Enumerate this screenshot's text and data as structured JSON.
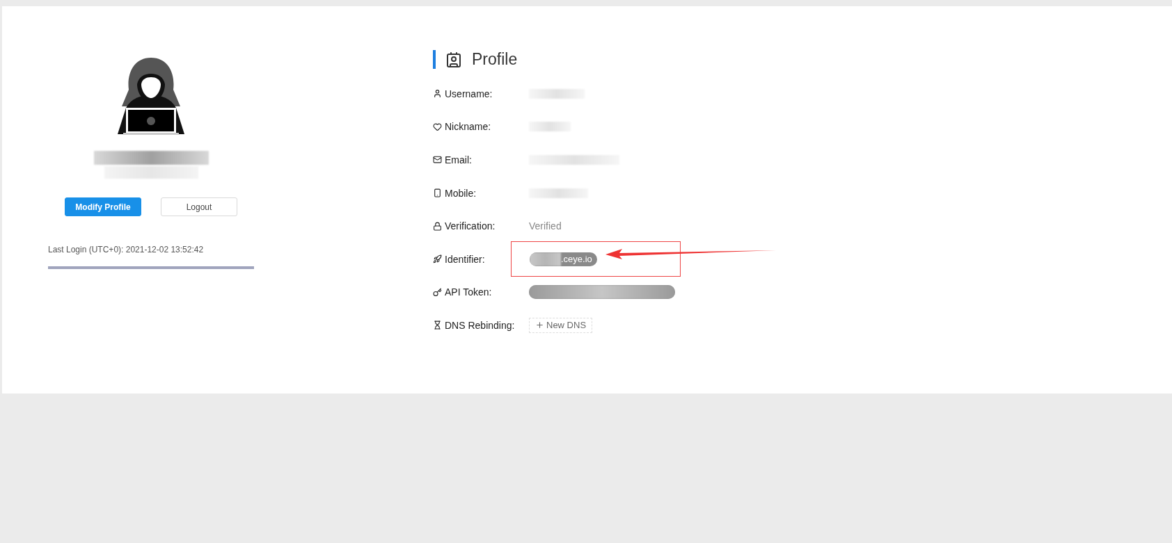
{
  "sidebar": {
    "buttons": [
      {
        "label": "Modify Profile",
        "kind": "primary"
      },
      {
        "label": "Logout",
        "kind": "default"
      }
    ],
    "last_login": "Last Login (UTC+0): 2021-12-02 13:52:42"
  },
  "profile": {
    "title": "Profile",
    "rows": [
      {
        "label": "Username:",
        "kind": "redacted"
      },
      {
        "label": "Nickname:",
        "kind": "redacted"
      },
      {
        "label": "Email:",
        "kind": "redacted"
      },
      {
        "label": "Mobile:",
        "kind": "redacted"
      },
      {
        "label": "Verification:",
        "kind": "status",
        "value": "Verified"
      },
      {
        "label": "Identifier:",
        "kind": "pill",
        "value": ".ceye.io",
        "annotated": true
      },
      {
        "label": "API Token:",
        "kind": "token"
      },
      {
        "label": "DNS Rebinding:",
        "kind": "button",
        "value": "New DNS"
      }
    ]
  }
}
